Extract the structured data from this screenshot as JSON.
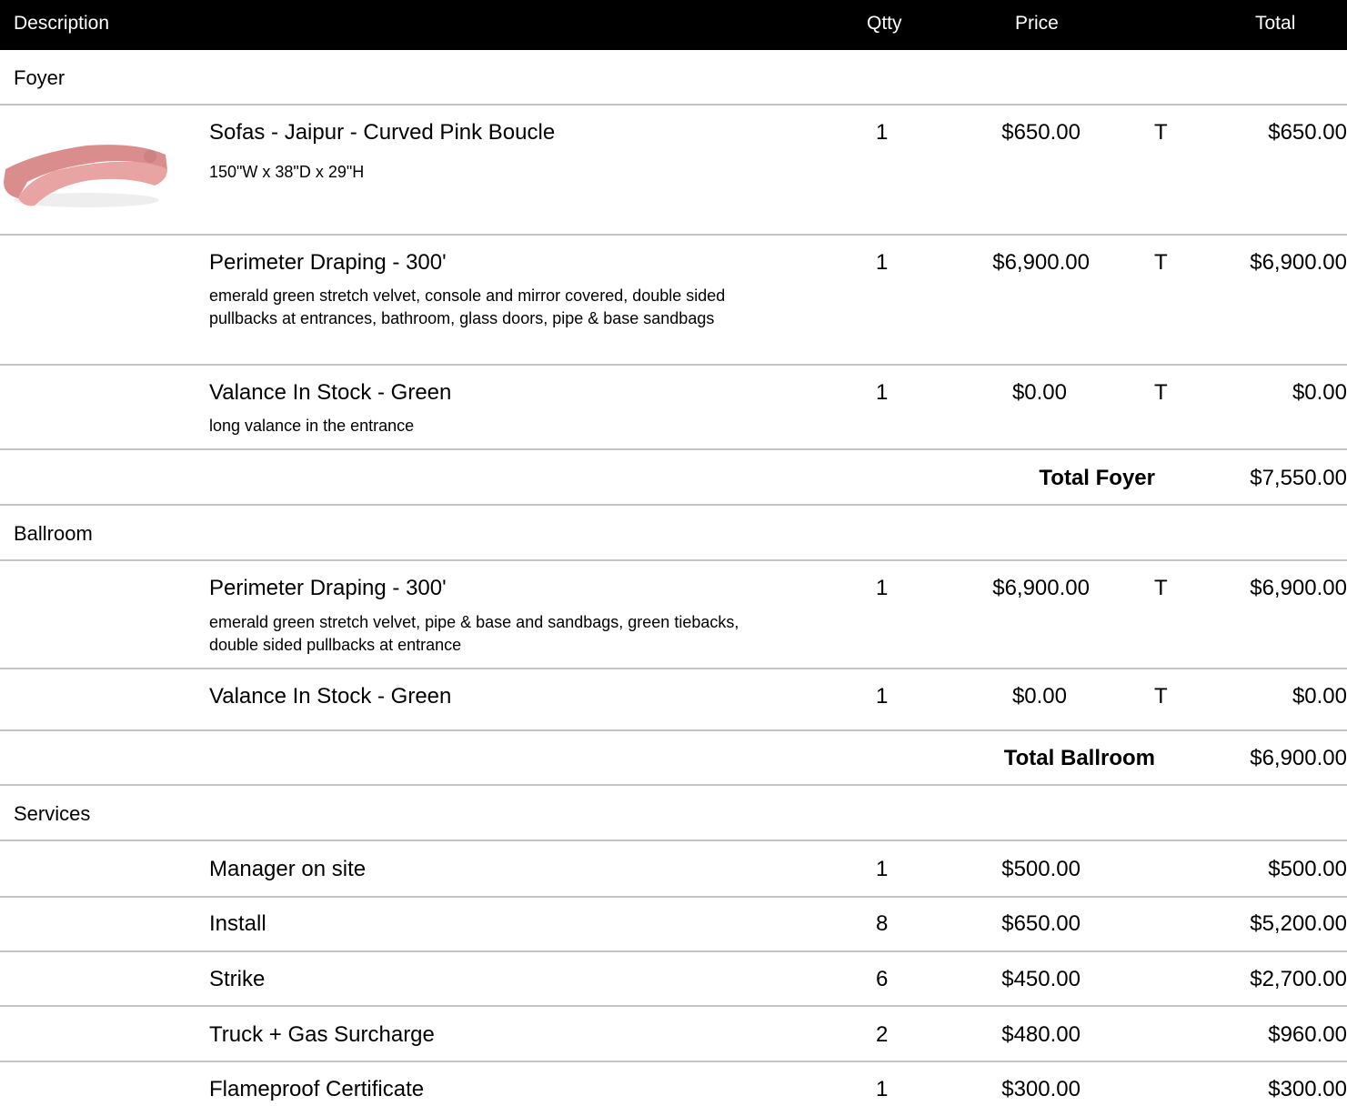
{
  "header": {
    "description": "Description",
    "qtty": "Qtty",
    "price": "Price",
    "total": "Total"
  },
  "sections": [
    {
      "name": "Foyer",
      "items": [
        {
          "name": "Sofas - Jaipur - Curved Pink Boucle",
          "details": "150\"W x 38\"D x 29\"H",
          "qty": "1",
          "price": "$650.00",
          "tax": "T",
          "total": "$650.00",
          "image": "pink-curved-sofa"
        },
        {
          "name": "Perimeter Draping - 300'",
          "details": "emerald green stretch velvet, console and mirror covered, double sided pullbacks at entrances, bathroom, glass doors, pipe & base sandbags",
          "qty": "1",
          "price": "$6,900.00",
          "tax": "T",
          "total": "$6,900.00"
        },
        {
          "name": "Valance In Stock - Green",
          "details": "long valance in the entrance",
          "qty": "1",
          "price": "$0.00",
          "tax": "T",
          "total": "$0.00"
        }
      ],
      "total_label": "Total Foyer",
      "total": "$7,550.00"
    },
    {
      "name": "Ballroom",
      "items": [
        {
          "name": "Perimeter Draping - 300'",
          "details": "emerald green stretch velvet, pipe & base and sandbags, green tiebacks, double sided pullbacks at entrance",
          "qty": "1",
          "price": "$6,900.00",
          "tax": "T",
          "total": "$6,900.00"
        },
        {
          "name": "Valance In Stock - Green",
          "qty": "1",
          "price": "$0.00",
          "tax": "T",
          "total": "$0.00"
        }
      ],
      "total_label": "Total Ballroom",
      "total": "$6,900.00"
    },
    {
      "name": "Services",
      "items": [
        {
          "name": "Manager on site",
          "qty": "1",
          "price": "$500.00",
          "total": "$500.00"
        },
        {
          "name": "Install",
          "qty": "8",
          "price": "$650.00",
          "total": "$5,200.00"
        },
        {
          "name": "Strike",
          "qty": "6",
          "price": "$450.00",
          "total": "$2,700.00"
        },
        {
          "name": "Truck + Gas Surcharge",
          "qty": "2",
          "price": "$480.00",
          "total": "$960.00"
        },
        {
          "name": "Flameproof Certificate",
          "qty": "1",
          "price": "$300.00",
          "total": "$300.00"
        }
      ]
    }
  ]
}
